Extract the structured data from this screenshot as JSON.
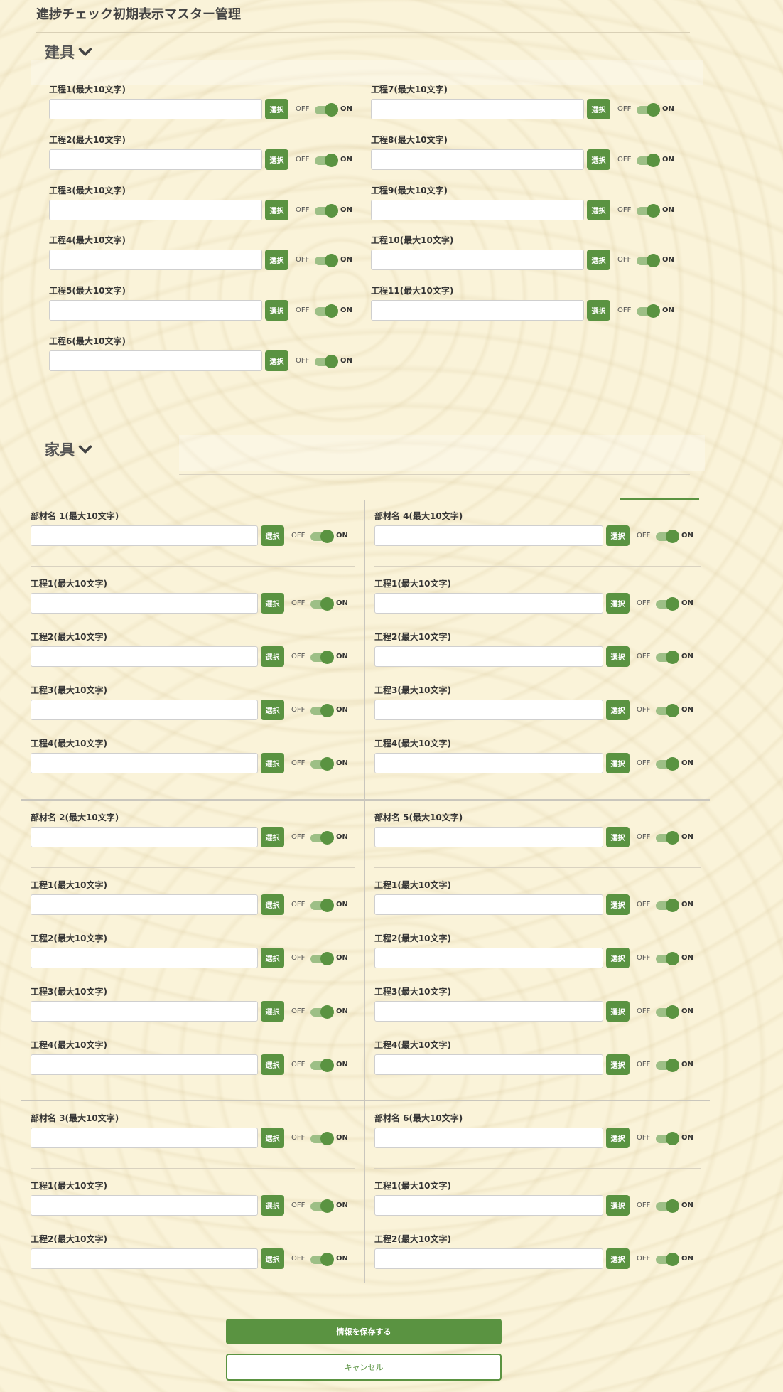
{
  "page": {
    "title": "進捗チェック初期表示マスター管理"
  },
  "colors": {
    "accent": "#5a9341",
    "toggle_track": "#9dbf86",
    "background": "#faf3d9"
  },
  "icons": {
    "section_toggle": "chevron-down-icon"
  },
  "toggle": {
    "off_label": "OFF",
    "on_label": "ON",
    "state": "on"
  },
  "select_label": "選択",
  "tategu": {
    "heading": "建具",
    "processes": [
      {
        "label": "工程1(最大10文字)",
        "value": ""
      },
      {
        "label": "工程2(最大10文字)",
        "value": ""
      },
      {
        "label": "工程3(最大10文字)",
        "value": ""
      },
      {
        "label": "工程4(最大10文字)",
        "value": ""
      },
      {
        "label": "工程5(最大10文字)",
        "value": ""
      },
      {
        "label": "工程6(最大10文字)",
        "value": ""
      },
      {
        "label": "工程7(最大10文字)",
        "value": ""
      },
      {
        "label": "工程8(最大10文字)",
        "value": ""
      },
      {
        "label": "工程9(最大10文字)",
        "value": ""
      },
      {
        "label": "工程10(最大10文字)",
        "value": ""
      },
      {
        "label": "工程11(最大10文字)",
        "value": ""
      }
    ]
  },
  "kagu": {
    "heading": "家具",
    "parts": [
      {
        "label": "部材名 1(最大10文字)",
        "value": "",
        "processes": [
          {
            "label": "工程1(最大10文字)",
            "value": ""
          },
          {
            "label": "工程2(最大10文字)",
            "value": ""
          },
          {
            "label": "工程3(最大10文字)",
            "value": ""
          },
          {
            "label": "工程4(最大10文字)",
            "value": ""
          }
        ]
      },
      {
        "label": "部材名 2(最大10文字)",
        "value": "",
        "processes": [
          {
            "label": "工程1(最大10文字)",
            "value": ""
          },
          {
            "label": "工程2(最大10文字)",
            "value": ""
          },
          {
            "label": "工程3(最大10文字)",
            "value": ""
          },
          {
            "label": "工程4(最大10文字)",
            "value": ""
          }
        ]
      },
      {
        "label": "部材名 3(最大10文字)",
        "value": "",
        "processes": [
          {
            "label": "工程1(最大10文字)",
            "value": ""
          },
          {
            "label": "工程2(最大10文字)",
            "value": ""
          }
        ]
      },
      {
        "label": "部材名 4(最大10文字)",
        "value": "",
        "processes": [
          {
            "label": "工程1(最大10文字)",
            "value": ""
          },
          {
            "label": "工程2(最大10文字)",
            "value": ""
          },
          {
            "label": "工程3(最大10文字)",
            "value": ""
          },
          {
            "label": "工程4(最大10文字)",
            "value": ""
          }
        ]
      },
      {
        "label": "部材名 5(最大10文字)",
        "value": "",
        "processes": [
          {
            "label": "工程1(最大10文字)",
            "value": ""
          },
          {
            "label": "工程2(最大10文字)",
            "value": ""
          },
          {
            "label": "工程3(最大10文字)",
            "value": ""
          },
          {
            "label": "工程4(最大10文字)",
            "value": ""
          }
        ]
      },
      {
        "label": "部材名 6(最大10文字)",
        "value": "",
        "processes": [
          {
            "label": "工程1(最大10文字)",
            "value": ""
          },
          {
            "label": "工程2(最大10文字)",
            "value": ""
          }
        ]
      }
    ]
  },
  "actions": {
    "save_label": "情報を保存する",
    "cancel_label": "キャンセル"
  }
}
